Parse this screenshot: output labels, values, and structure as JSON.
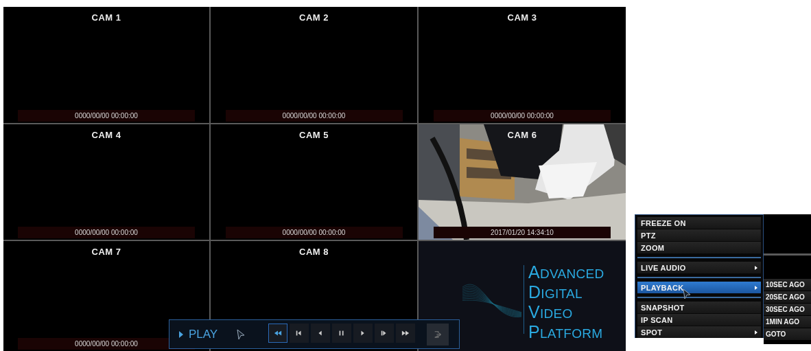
{
  "cameras": [
    {
      "label": "CAM 1",
      "timestamp": "0000/00/00 00:00:00",
      "kind": "empty"
    },
    {
      "label": "CAM 2",
      "timestamp": "0000/00/00 00:00:00",
      "kind": "empty"
    },
    {
      "label": "CAM 3",
      "timestamp": "0000/00/00 00:00:00",
      "kind": "empty"
    },
    {
      "label": "CAM 4",
      "timestamp": "0000/00/00 00:00:00",
      "kind": "empty"
    },
    {
      "label": "CAM 5",
      "timestamp": "0000/00/00 00:00:00",
      "kind": "empty"
    },
    {
      "label": "CAM 6",
      "timestamp": "2017/01/20 14:34:10",
      "kind": "picture"
    },
    {
      "label": "CAM 7",
      "timestamp": "0000/00/00 00:00:00",
      "kind": "empty"
    },
    {
      "label": "CAM 8",
      "kind": "empty"
    }
  ],
  "logo": {
    "lines": [
      "ADVANCED",
      "DIGITAL",
      "VIDEO",
      "PLATFORM"
    ]
  },
  "playbar": {
    "label": "PLAY",
    "buttons": [
      {
        "kind": "fast-rewind",
        "selected": true
      },
      {
        "kind": "step-back",
        "selected": false
      },
      {
        "kind": "reverse",
        "selected": false
      },
      {
        "kind": "pause",
        "selected": false
      },
      {
        "kind": "play",
        "selected": false
      },
      {
        "kind": "step-forward",
        "selected": false
      },
      {
        "kind": "fast-forward",
        "selected": false
      },
      {
        "kind": "exit",
        "selected": false
      }
    ]
  },
  "context_menu": {
    "items": [
      {
        "kind": "item",
        "label": "FREEZE ON",
        "submenu": false,
        "selected": false
      },
      {
        "kind": "item",
        "label": "PTZ",
        "submenu": false,
        "selected": false
      },
      {
        "kind": "item",
        "label": "ZOOM",
        "submenu": false,
        "selected": false
      },
      {
        "kind": "separator"
      },
      {
        "kind": "item",
        "label": "LIVE AUDIO",
        "submenu": true,
        "selected": false
      },
      {
        "kind": "separator"
      },
      {
        "kind": "item",
        "label": "PLAYBACK",
        "submenu": true,
        "selected": true
      },
      {
        "kind": "separator"
      },
      {
        "kind": "item",
        "label": "SNAPSHOT",
        "submenu": false,
        "selected": false
      },
      {
        "kind": "item",
        "label": "IP SCAN",
        "submenu": false,
        "selected": false
      },
      {
        "kind": "item",
        "label": "SPOT",
        "submenu": true,
        "selected": false
      }
    ]
  },
  "submenu": {
    "items": [
      "10SEC AGO",
      "20SEC AGO",
      "30SEC AGO",
      "1MIN AGO",
      "GOTO"
    ]
  }
}
